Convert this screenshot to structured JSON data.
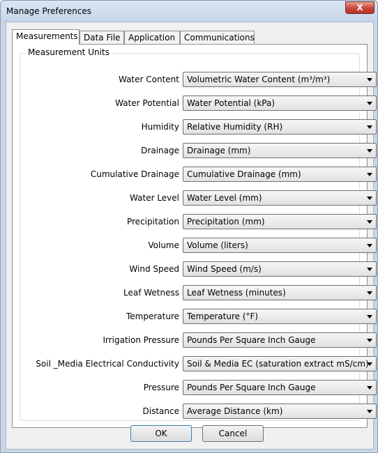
{
  "window": {
    "title": "Manage Preferences",
    "close_glyph": "X"
  },
  "tabs": [
    {
      "label": "Measurements",
      "active": true
    },
    {
      "label": "Data File",
      "active": false
    },
    {
      "label": "Application",
      "active": false
    },
    {
      "label": "Communications",
      "active": false
    }
  ],
  "group": {
    "title": "Measurement Units"
  },
  "rows": [
    {
      "label": "Water Content",
      "value": "Volumetric Water Content (m³/m³)"
    },
    {
      "label": "Water Potential",
      "value": "Water Potential (kPa)"
    },
    {
      "label": "Humidity",
      "value": "Relative Humidity (RH)"
    },
    {
      "label": "Drainage",
      "value": "Drainage (mm)"
    },
    {
      "label": "Cumulative Drainage",
      "value": "Cumulative Drainage (mm)"
    },
    {
      "label": "Water Level",
      "value": "Water Level (mm)"
    },
    {
      "label": "Precipitation",
      "value": "Precipitation (mm)"
    },
    {
      "label": "Volume",
      "value": "Volume (liters)"
    },
    {
      "label": "Wind Speed",
      "value": "Wind Speed (m/s)"
    },
    {
      "label": "Leaf Wetness",
      "value": "Leaf Wetness (minutes)"
    },
    {
      "label": "Temperature",
      "value": "Temperature (°F)"
    },
    {
      "label": "Irrigation Pressure",
      "value": "Pounds Per Square Inch Gauge"
    },
    {
      "label": "Soil _Media Electrical Conductivity",
      "value": "Soil & Media EC (saturation extract mS/cm)"
    },
    {
      "label": "Pressure",
      "value": "Pounds Per Square Inch Gauge"
    },
    {
      "label": "Distance",
      "value": "Average Distance (km)"
    }
  ],
  "buttons": {
    "ok": "OK",
    "cancel": "Cancel"
  }
}
